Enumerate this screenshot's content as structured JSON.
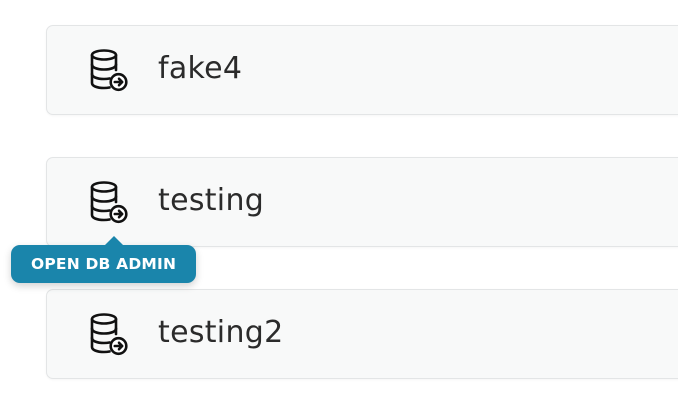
{
  "databases": [
    {
      "name": "fake4",
      "icon": "database-open-icon"
    },
    {
      "name": "testing",
      "icon": "database-open-icon"
    },
    {
      "name": "testing2",
      "icon": "database-open-icon"
    }
  ],
  "tooltip": {
    "label": "OPEN DB ADMIN"
  },
  "colors": {
    "card_background": "#f8f9f9",
    "card_border": "#e3e5e6",
    "tooltip_background": "#1a85ab",
    "text": "#2b2b2b"
  }
}
